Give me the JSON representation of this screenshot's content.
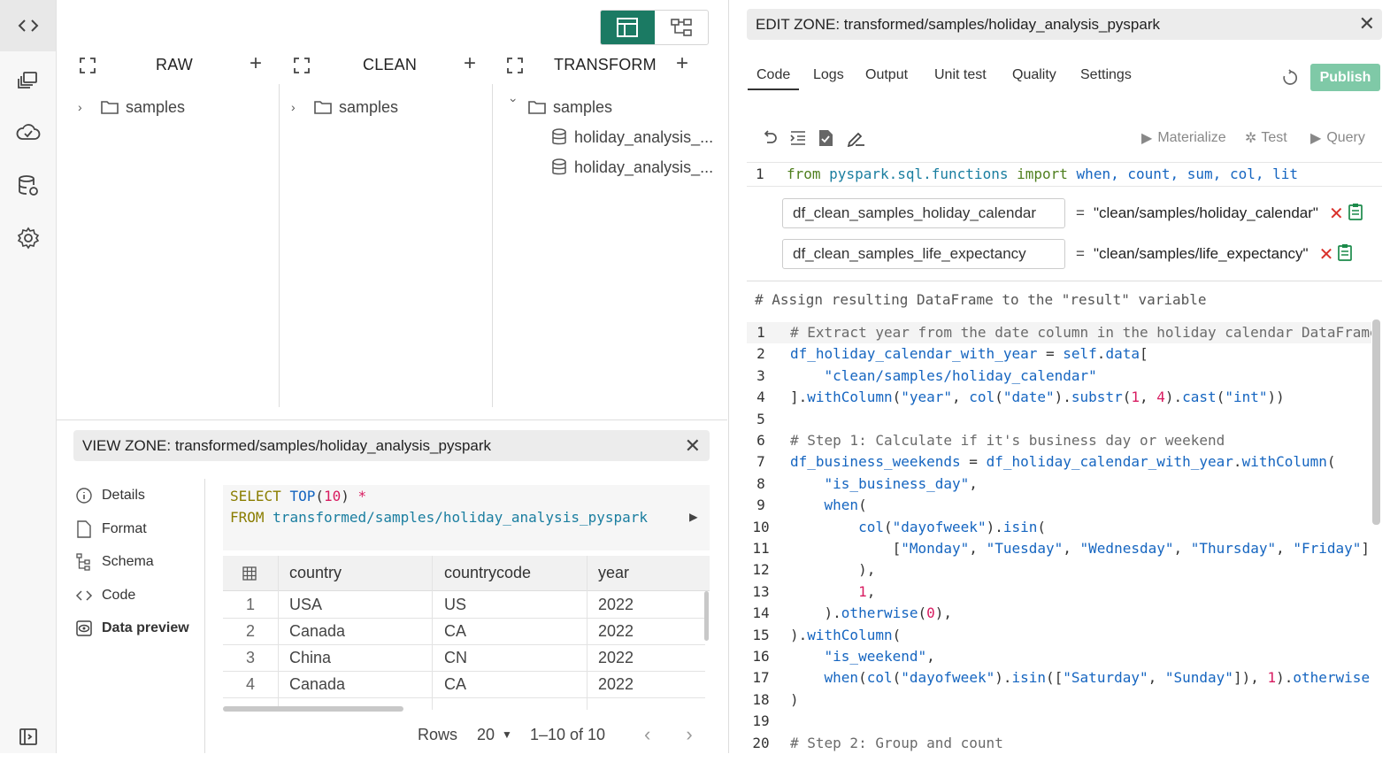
{
  "explorer": {
    "columns": [
      {
        "title": "RAW",
        "items": [
          {
            "label": "samples",
            "expanded": false
          }
        ]
      },
      {
        "title": "CLEAN",
        "items": [
          {
            "label": "samples",
            "expanded": false
          }
        ]
      },
      {
        "title": "TRANSFORM",
        "items": [
          {
            "label": "samples",
            "expanded": true
          },
          {
            "label": "holiday_analysis_..."
          },
          {
            "label": "holiday_analysis_..."
          }
        ]
      }
    ]
  },
  "view_zone": {
    "title": "VIEW ZONE: transformed/samples/holiday_analysis_pyspark",
    "nav": [
      "Details",
      "Format",
      "Schema",
      "Code",
      "Data preview"
    ],
    "sql": {
      "line1_kw": "SELECT",
      "line1_fn": "TOP",
      "line1_num": "10",
      "line1_rest": "*",
      "line2_kw": "FROM",
      "line2_path": "transformed/samples/holiday_analysis_pyspark"
    },
    "table": {
      "columns": [
        "country",
        "countrycode",
        "year"
      ],
      "rows": [
        {
          "n": "1",
          "country": "USA",
          "countrycode": "US",
          "year": "2022"
        },
        {
          "n": "2",
          "country": "Canada",
          "countrycode": "CA",
          "year": "2022"
        },
        {
          "n": "3",
          "country": "China",
          "countrycode": "CN",
          "year": "2022"
        },
        {
          "n": "4",
          "country": "Canada",
          "countrycode": "CA",
          "year": "2022"
        }
      ]
    },
    "pager": {
      "rows_label": "Rows",
      "page_size": "20",
      "range": "1–10 of 10"
    }
  },
  "edit_zone": {
    "title": "EDIT ZONE: transformed/samples/holiday_analysis_pyspark",
    "tabs": [
      "Code",
      "Logs",
      "Output",
      "Unit test",
      "Quality",
      "Settings"
    ],
    "publish_label": "Publish",
    "actions": [
      "Materialize",
      "Test",
      "Query"
    ],
    "import_line": {
      "n": "1",
      "text": "from pyspark.sql.functions import when, count, sum, col, lit"
    },
    "inputs": [
      {
        "name": "df_clean_samples_holiday_calendar",
        "eq": "=",
        "value": "\"clean/samples/holiday_calendar\""
      },
      {
        "name": "df_clean_samples_life_expectancy",
        "eq": "=",
        "value": "\"clean/samples/life_expectancy\""
      }
    ],
    "assign_comment": "# Assign resulting DataFrame to the \"result\" variable",
    "code_lines": [
      "# Extract year from the date column in the holiday calendar DataFrame",
      "df_holiday_calendar_with_year = self.data[",
      "    \"clean/samples/holiday_calendar\"",
      "].withColumn(\"year\", col(\"date\").substr(1, 4).cast(\"int\"))",
      "",
      "# Step 1: Calculate if it's business day or weekend",
      "df_business_weekends = df_holiday_calendar_with_year.withColumn(",
      "    \"is_business_day\",",
      "    when(",
      "        col(\"dayofweek\").isin(",
      "            [\"Monday\", \"Tuesday\", \"Wednesday\", \"Thursday\", \"Friday\"]",
      "        ),",
      "        1,",
      "    ).otherwise(0),",
      ").withColumn(",
      "    \"is_weekend\",",
      "    when(col(\"dayofweek\").isin([\"Saturday\", \"Sunday\"]), 1).otherwise",
      ")",
      "",
      "# Step 2: Group and count"
    ]
  },
  "colors": {
    "accent": "#1b7a63",
    "publish": "#7fc9a7",
    "delete": "#d9312b",
    "clipboard": "#1b8a4a"
  }
}
